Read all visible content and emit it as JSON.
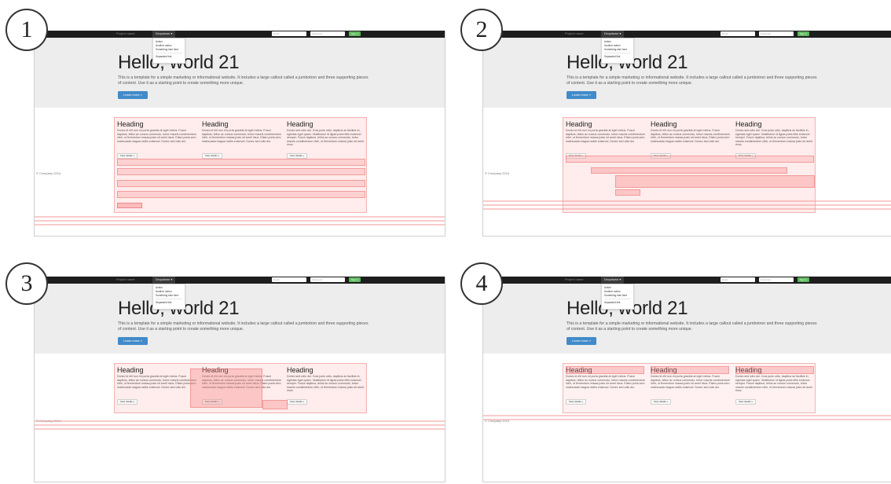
{
  "badges": [
    "1",
    "2",
    "3",
    "4"
  ],
  "navbar": {
    "brand": "Project name",
    "dropdown": "Dropdown ▾",
    "email_placeholder": "Email",
    "password_placeholder": "Password",
    "signin": "Sign in"
  },
  "dropdown_menu": {
    "items": [
      "Action",
      "Another action",
      "Something else here"
    ],
    "separated": "Separated link"
  },
  "jumbotron": {
    "title": "Hello, world 21",
    "description": "This is a template for a simple marketing or informational website. It includes a large callout called a jumbotron and three supporting pieces of content. Use it as a starting point to create something more unique.",
    "button": "Learn more »"
  },
  "columns": [
    {
      "heading": "Heading",
      "text": "Donec id elit non mi porta gravida at eget metus. Fusce dapibus, tellus ac cursus commodo, tortor mauris condimentum nibh, ut fermentum massa justo sit amet risus. Etiam porta sem malesuada magna mollis euismod. Donec sed odio dui.",
      "button": "View details »"
    },
    {
      "heading": "Heading",
      "text": "Donec id elit non mi porta gravida at eget metus. Fusce dapibus, tellus ac cursus commodo, tortor mauris condimentum nibh, ut fermentum massa justo sit amet risus. Etiam porta sem malesuada magna mollis euismod. Donec sed odio dui.",
      "button": "View details »"
    },
    {
      "heading": "Heading",
      "text": "Donec sed odio dui. Cras justo odio, dapibus ac facilisis in, egestas eget quam. Vestibulum id ligula porta felis euismod semper. Fusce dapibus, tellus ac cursus commodo, tortor mauris condimentum nibh, ut fermentum massa justo sit amet risus.",
      "button": "View details »"
    }
  ],
  "footer": "© Company 2014"
}
